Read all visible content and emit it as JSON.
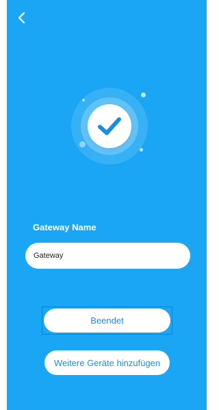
{
  "header": {
    "back_icon": "chevron-left-icon"
  },
  "status": {
    "icon": "checkmark-icon",
    "colors": {
      "background": "#1aa6f5",
      "check": "#1a8fe0"
    }
  },
  "form": {
    "label": "Gateway Name",
    "input_value": "Gateway"
  },
  "actions": {
    "done_label": "Beendet",
    "add_more_label": "Weitere Geräte hinzufügen",
    "highlight_color": "#d83a3a"
  }
}
